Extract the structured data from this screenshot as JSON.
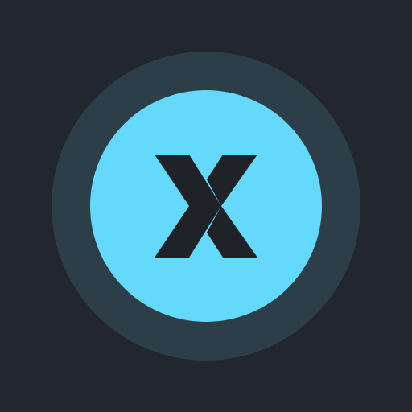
{
  "button": {
    "glyph_text": "X",
    "icon": "x-glyph-icon"
  },
  "colors": {
    "background": "#22262f",
    "ring": "#2c3f49",
    "face": "#64d9fb",
    "glyph": "#1f2328"
  }
}
